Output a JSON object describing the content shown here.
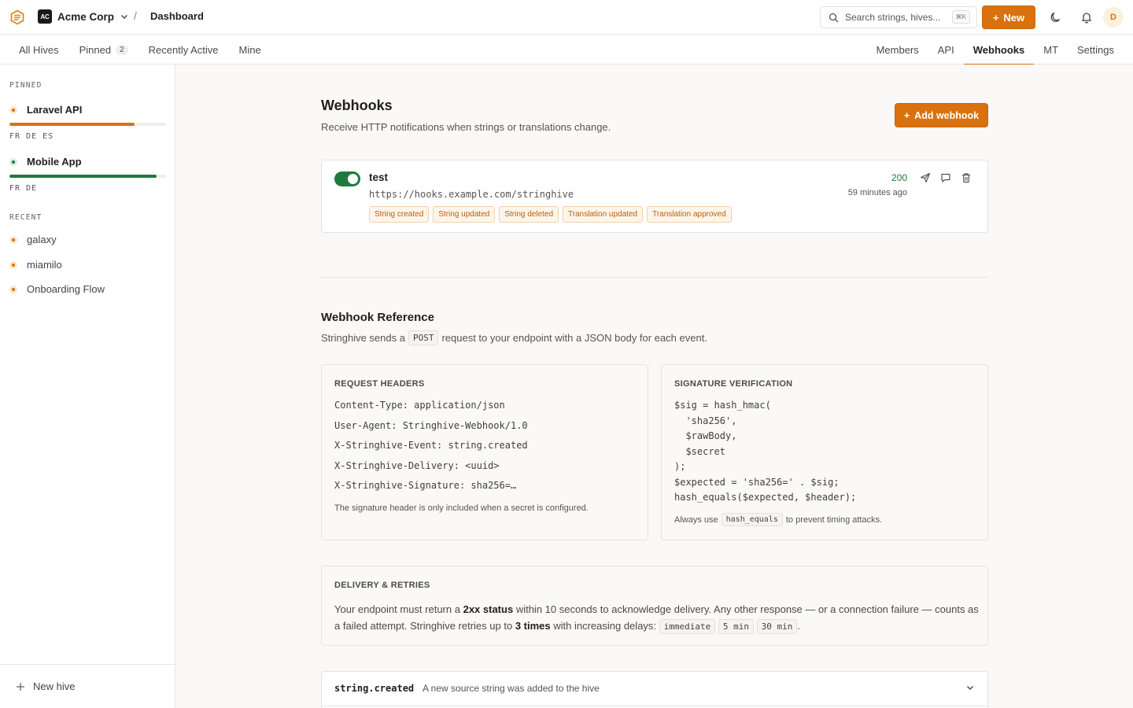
{
  "topbar": {
    "org_badge": "AC",
    "org_name": "Acme Corp",
    "crumb_sep": "/",
    "crumb": "Dashboard",
    "search_placeholder": "Search strings, hives...",
    "search_kbd": "⌘K",
    "new_label": "New",
    "avatar_initial": "D"
  },
  "nav": {
    "left": [
      {
        "label": "All Hives"
      },
      {
        "label": "Pinned",
        "count": "2"
      },
      {
        "label": "Recently Active"
      },
      {
        "label": "Mine"
      }
    ],
    "tabs": [
      {
        "label": "Members"
      },
      {
        "label": "API"
      },
      {
        "label": "Webhooks",
        "active": true
      },
      {
        "label": "MT"
      },
      {
        "label": "Settings"
      }
    ]
  },
  "sidebar": {
    "pinned_heading": "PINNED",
    "pinned": [
      {
        "name": "Laravel API",
        "langs": "FR DE ES",
        "progress": 0.8,
        "color": "#d9720d"
      },
      {
        "name": "Mobile App",
        "langs": "FR DE",
        "progress": 0.94,
        "color": "#1f7a3d"
      }
    ],
    "recent_heading": "RECENT",
    "recent": [
      {
        "name": "galaxy"
      },
      {
        "name": "miamilo"
      },
      {
        "name": "Onboarding Flow"
      }
    ],
    "new_hive_label": "New hive"
  },
  "main": {
    "title": "Webhooks",
    "subtitle": "Receive HTTP notifications when strings or translations change.",
    "add_label": "Add webhook",
    "webhook": {
      "name": "test",
      "url": "https://hooks.example.com/stringhive",
      "events": [
        "String created",
        "String updated",
        "String deleted",
        "Translation updated",
        "Translation approved"
      ],
      "status_code": "200",
      "last_delivery": "59 minutes ago",
      "enabled": true
    },
    "reference": {
      "title": "Webhook Reference",
      "intro_before": "Stringhive sends a",
      "intro_code": "POST",
      "intro_after": "request to your endpoint with a JSON body for each event.",
      "headers_title": "REQUEST HEADERS",
      "headers": [
        "Content-Type: application/json",
        "User-Agent: Stringhive-Webhook/1.0",
        "X-Stringhive-Event: string.created",
        "X-Stringhive-Delivery: <uuid>",
        "X-Stringhive-Signature: sha256=…"
      ],
      "headers_note": "The signature header is only included when a secret is configured.",
      "sig_title": "SIGNATURE VERIFICATION",
      "sig_code": [
        "$sig = hash_hmac(",
        "  'sha256',",
        "  $rawBody,",
        "  $secret",
        ");",
        "$expected = 'sha256=' . $sig;",
        "hash_equals($expected, $header);"
      ],
      "sig_note_before": "Always use",
      "sig_note_code": "hash_equals",
      "sig_note_after": "to prevent timing attacks."
    },
    "delivery": {
      "title": "DELIVERY & RETRIES",
      "p1": "Your endpoint must return a",
      "b1": "2xx status",
      "p2": "within 10 seconds to acknowledge delivery. Any other response — or a connection failure — counts as a failed attempt. Stringhive retries up to",
      "b2": "3 times",
      "p3": "with increasing delays:",
      "delays": [
        "immediate",
        "5 min",
        "30 min"
      ],
      "end": "."
    },
    "event": {
      "name": "string.created",
      "description": "A new source string was added to the hive"
    }
  }
}
